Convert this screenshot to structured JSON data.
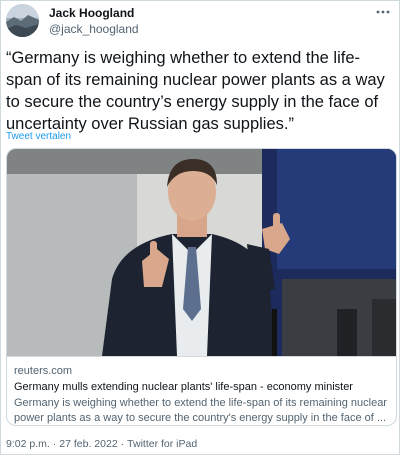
{
  "author": {
    "name": "Jack Hoogland",
    "handle": "@jack_hoogland"
  },
  "more_icon": "more-horizontal-icon",
  "tweet_text": "“Germany is weighing whether to extend the life-span of its remaining nuclear power plants as a way to secure the country’s energy supply in the face of uncertainty over Russian gas supplies.”",
  "translate_label": "Tweet vertalen",
  "card": {
    "domain": "reuters.com",
    "title": "Germany mulls extending nuclear plants' life-span - economy minister",
    "description": "Germany is weighing whether to extend the life-span of its remaining nuclear power plants as a way to secure the country's energy supply in the face of ..."
  },
  "meta": {
    "time": "9:02 p.m.",
    "separator": "·",
    "date": "27 feb. 2022",
    "source": "Twitter for iPad"
  },
  "colors": {
    "link": "#1d9bf0",
    "secondary_text": "#536471",
    "border": "#cfd9de"
  }
}
